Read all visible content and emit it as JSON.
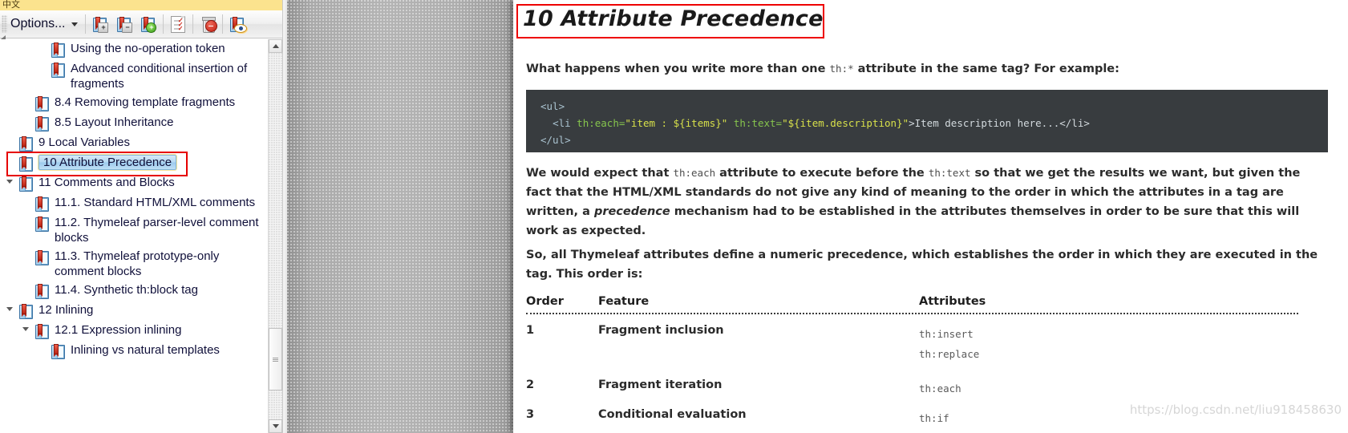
{
  "notice": {
    "text": "中文"
  },
  "toolbar": {
    "options_label": "Options...",
    "buttons": [
      {
        "name": "expand-all-bookmarks-button",
        "icon": "bookmark-expand-icon",
        "badge": "+"
      },
      {
        "name": "collapse-all-bookmarks-button",
        "icon": "bookmark-collapse-icon",
        "badge": "−"
      },
      {
        "name": "new-bookmark-button",
        "icon": "bookmark-add-icon",
        "badge": "+"
      },
      {
        "name": "bookmark-properties-button",
        "icon": "document-properties-icon",
        "badge": ""
      },
      {
        "name": "delete-bookmark-button",
        "icon": "trash-delete-icon",
        "badge": "−"
      },
      {
        "name": "highlight-bookmark-button",
        "icon": "bookmark-eye-icon",
        "badge": ""
      }
    ]
  },
  "tree": {
    "items": [
      {
        "label": "Using the no-operation token",
        "indent": 2,
        "twisty": "none",
        "selected": false
      },
      {
        "label": "Advanced conditional insertion of fragments",
        "indent": 2,
        "twisty": "none",
        "selected": false
      },
      {
        "label": "8.4 Removing template fragments",
        "indent": 1,
        "twisty": "none",
        "selected": false
      },
      {
        "label": "8.5 Layout Inheritance",
        "indent": 1,
        "twisty": "none",
        "selected": false
      },
      {
        "label": "9 Local Variables",
        "indent": 0,
        "twisty": "none",
        "selected": false
      },
      {
        "label": "10 Attribute Precedence",
        "indent": 0,
        "twisty": "none",
        "selected": true
      },
      {
        "label": "11 Comments and Blocks",
        "indent": 0,
        "twisty": "open",
        "selected": false
      },
      {
        "label": "11.1. Standard HTML/XML comments",
        "indent": 1,
        "twisty": "none",
        "selected": false
      },
      {
        "label": "11.2. Thymeleaf parser-level comment blocks",
        "indent": 1,
        "twisty": "none",
        "selected": false
      },
      {
        "label": "11.3. Thymeleaf prototype-only comment blocks",
        "indent": 1,
        "twisty": "none",
        "selected": false
      },
      {
        "label": "11.4. Synthetic th:block tag",
        "indent": 1,
        "twisty": "none",
        "selected": false
      },
      {
        "label": "12 Inlining",
        "indent": 0,
        "twisty": "open",
        "selected": false
      },
      {
        "label": "12.1 Expression inlining",
        "indent": 1,
        "twisty": "open",
        "selected": false
      },
      {
        "label": "Inlining vs natural templates",
        "indent": 2,
        "twisty": "none",
        "selected": false
      }
    ]
  },
  "document": {
    "title": "10 Attribute Precedence",
    "intro_before": "What happens when you write more than one ",
    "intro_code": "th:*",
    "intro_after": " attribute in the same tag? For example:",
    "code": {
      "line1_tag": "<ul>",
      "line2": {
        "open": "<li ",
        "attr1": "th:each=",
        "val1": "\"item : ${items}\"",
        "attr2": " th:text=",
        "val2": "\"${item.description}\"",
        "close": ">Item description here...</li>"
      },
      "line3_tag": "</ul>"
    },
    "paragraph2": {
      "p1": "We would expect that ",
      "c1": "th:each",
      "p2": " attribute to execute before the ",
      "c2": "th:text",
      "p3": " so that we get the results we want, but given the fact that the HTML/XML standards do not give any kind of meaning to the order in which the attributes in a tag are written, a ",
      "em": "precedence",
      "p4": " mechanism had to be established in the attributes themselves in order to be sure that this will work as expected."
    },
    "paragraph3": "So, all Thymeleaf attributes define a numeric precedence, which establishes the order in which they are executed in the tag. This order is:",
    "table": {
      "headers": [
        "Order",
        "Feature",
        "Attributes"
      ],
      "rows": [
        {
          "order": "1",
          "feature": "Fragment inclusion",
          "attributes": "th:insert\nth:replace"
        },
        {
          "order": "2",
          "feature": "Fragment iteration",
          "attributes": "th:each"
        },
        {
          "order": "3",
          "feature": "Conditional evaluation",
          "attributes": "th:if"
        }
      ]
    },
    "watermark": "https://blog.csdn.net/liu918458630"
  }
}
